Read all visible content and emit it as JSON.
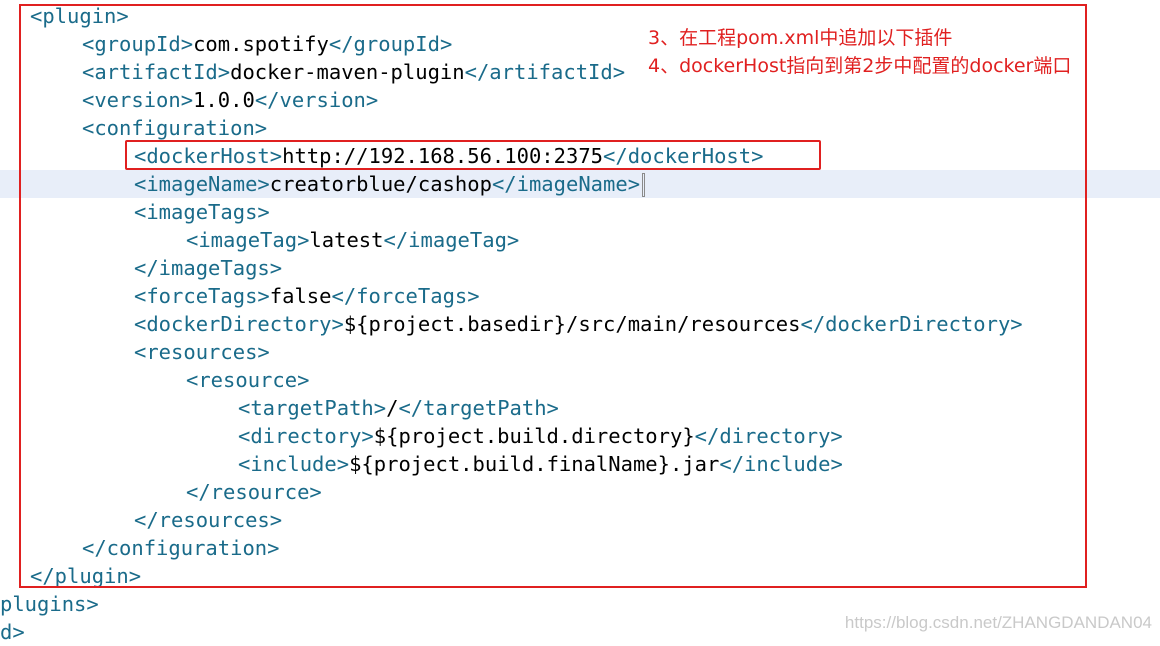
{
  "editor": {
    "lines": [
      {
        "parts": [
          {
            "t": "tag",
            "v": "<plugin>"
          }
        ]
      },
      {
        "parts": [
          {
            "t": "tag",
            "v": "<groupId>"
          },
          {
            "t": "txt",
            "v": "com.spotify"
          },
          {
            "t": "tag",
            "v": "</groupId>"
          }
        ]
      },
      {
        "parts": [
          {
            "t": "tag",
            "v": "<artifactId>"
          },
          {
            "t": "txt",
            "v": "docker-maven-plugin"
          },
          {
            "t": "tag",
            "v": "</artifactId>"
          }
        ]
      },
      {
        "parts": [
          {
            "t": "tag",
            "v": "<version>"
          },
          {
            "t": "txt",
            "v": "1.0.0"
          },
          {
            "t": "tag",
            "v": "</version>"
          }
        ]
      },
      {
        "parts": [
          {
            "t": "tag",
            "v": "<configuration>"
          }
        ]
      },
      {
        "parts": [
          {
            "t": "tag",
            "v": "<dockerHost>"
          },
          {
            "t": "txt",
            "v": "http://192.168.56.100:2375"
          },
          {
            "t": "tag",
            "v": "</dockerHost>"
          }
        ]
      },
      {
        "parts": [
          {
            "t": "tag",
            "v": "<imageName>"
          },
          {
            "t": "txt",
            "v": "creatorblue/cashop"
          },
          {
            "t": "tag",
            "v": "</imageName>"
          }
        ]
      },
      {
        "parts": [
          {
            "t": "tag",
            "v": "<imageTags>"
          }
        ]
      },
      {
        "parts": [
          {
            "t": "tag",
            "v": "<imageTag>"
          },
          {
            "t": "txt",
            "v": "latest"
          },
          {
            "t": "tag",
            "v": "</imageTag>"
          }
        ]
      },
      {
        "parts": [
          {
            "t": "tag",
            "v": "</imageTags>"
          }
        ]
      },
      {
        "parts": [
          {
            "t": "tag",
            "v": "<forceTags>"
          },
          {
            "t": "txt",
            "v": "false"
          },
          {
            "t": "tag",
            "v": "</forceTags>"
          }
        ]
      },
      {
        "parts": [
          {
            "t": "tag",
            "v": "<dockerDirectory>"
          },
          {
            "t": "txt",
            "v": "${project.basedir}/src/main/resources"
          },
          {
            "t": "tag",
            "v": "</dockerDirectory>"
          }
        ]
      },
      {
        "parts": [
          {
            "t": "tag",
            "v": "<resources>"
          }
        ]
      },
      {
        "parts": [
          {
            "t": "tag",
            "v": "<resource>"
          }
        ]
      },
      {
        "parts": [
          {
            "t": "tag",
            "v": "<targetPath>"
          },
          {
            "t": "txt",
            "v": "/"
          },
          {
            "t": "tag",
            "v": "</targetPath>"
          }
        ]
      },
      {
        "parts": [
          {
            "t": "tag",
            "v": "<directory>"
          },
          {
            "t": "txt",
            "v": "${project.build.directory}"
          },
          {
            "t": "tag",
            "v": "</directory>"
          }
        ]
      },
      {
        "parts": [
          {
            "t": "tag",
            "v": "<include>"
          },
          {
            "t": "txt",
            "v": "${project.build.finalName}.jar"
          },
          {
            "t": "tag",
            "v": "</include>"
          }
        ]
      },
      {
        "parts": [
          {
            "t": "tag",
            "v": "</resource>"
          }
        ]
      },
      {
        "parts": [
          {
            "t": "tag",
            "v": "</resources>"
          }
        ]
      },
      {
        "parts": [
          {
            "t": "tag",
            "v": "</configuration>"
          }
        ]
      },
      {
        "parts": [
          {
            "t": "tag",
            "v": "</plugin>"
          }
        ]
      },
      {
        "parts": [
          {
            "t": "tag",
            "v": "plugins>"
          }
        ]
      },
      {
        "parts": [
          {
            "t": "tag",
            "v": "d>"
          }
        ]
      }
    ]
  },
  "annotation": {
    "line1": "3、在工程pom.xml中追加以下插件",
    "line2": "4、dockerHost指向到第2步中配置的docker端口"
  },
  "watermark": "https://blog.csdn.net/ZHANGDANDAN04",
  "colors": {
    "tag": "#1a6b8a",
    "text": "#000000",
    "highlight_box": "#e02020",
    "current_line": "#e8eef9"
  }
}
